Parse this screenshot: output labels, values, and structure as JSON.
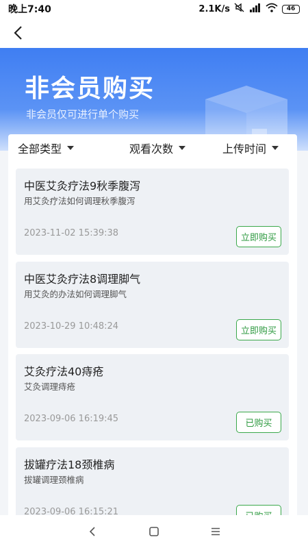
{
  "status_bar": {
    "time": "晚上7:40",
    "net_speed": "2.1K/s",
    "battery": "46"
  },
  "nav": {
    "back_icon": "chevron-left-icon"
  },
  "banner": {
    "title": "非会员购买",
    "subtitle": "非会员仅可进行单个购买"
  },
  "filters": [
    {
      "label": "全部类型"
    },
    {
      "label": "观看次数"
    },
    {
      "label": "上传时间"
    }
  ],
  "items": [
    {
      "title": "中医艾灸疗法9秋季腹泻",
      "desc": "用艾灸疗法如何调理秋季腹泻",
      "date": "2023-11-02 15:39:38",
      "action": "立即购买"
    },
    {
      "title": "中医艾灸疗法8调理脚气",
      "desc": "用艾灸的办法如何调理脚气",
      "date": "2023-10-29 10:48:24",
      "action": "立即购买"
    },
    {
      "title": "艾灸疗法40痔疮",
      "desc": "艾灸调理痔疮",
      "date": "2023-09-06 16:19:45",
      "action": "已购买"
    },
    {
      "title": "拔罐疗法18颈椎病",
      "desc": "拔罐调理颈椎病",
      "date": "2023-09-06 16:15:21",
      "action": "已购买"
    }
  ],
  "colors": {
    "accent": "#3f7ef2",
    "button_green": "#2f9a41"
  }
}
